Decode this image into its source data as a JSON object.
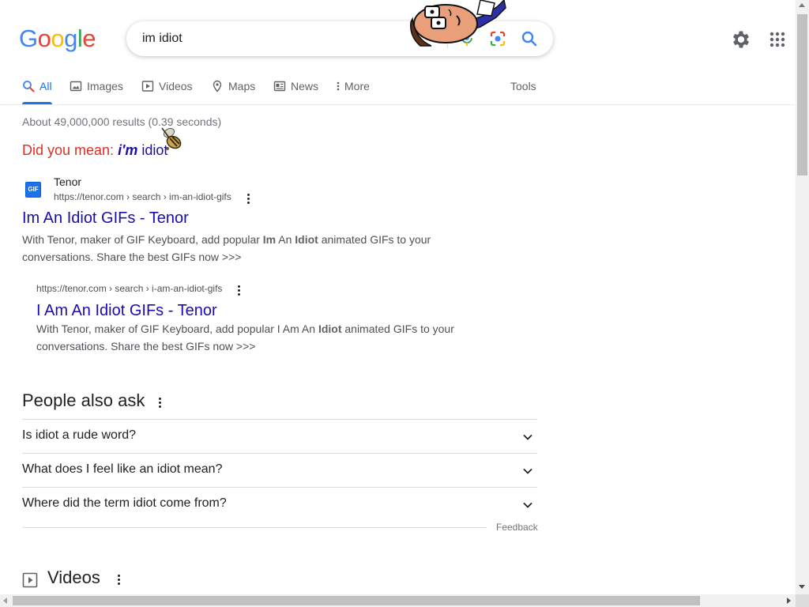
{
  "header": {
    "logo": {
      "letters": [
        "G",
        "o",
        "o",
        "g",
        "l",
        "e"
      ],
      "colors": [
        "#4285F4",
        "#EA4335",
        "#FBBC05",
        "#4285F4",
        "#34A853",
        "#EA4335"
      ]
    },
    "search": {
      "value": "im idiot"
    }
  },
  "tabs": [
    {
      "label": "All",
      "icon": "search-icon",
      "active": true
    },
    {
      "label": "Images",
      "icon": "image-icon"
    },
    {
      "label": "Videos",
      "icon": "play-icon"
    },
    {
      "label": "Maps",
      "icon": "map-pin-icon"
    },
    {
      "label": "News",
      "icon": "newspaper-icon"
    },
    {
      "label": "More",
      "icon": "more-vert-icon"
    },
    {
      "label": "Tools"
    }
  ],
  "results": {
    "stats": "About 49,000,000 results (0.39 seconds)",
    "did_you_mean": {
      "prefix": "Did you mean: ",
      "correction_bold": "i'm",
      "correction_rest": " idiot"
    },
    "items": [
      {
        "site": "Tenor",
        "favicon_text": "GIF",
        "url": "https://tenor.com › search › im-an-idiot-gifs",
        "title": "Im An Idiot GIFs - Tenor",
        "snippet": [
          {
            "t": "With Tenor, maker of GIF Keyboard, add popular "
          },
          {
            "t": "Im",
            "b": true
          },
          {
            "t": " An "
          },
          {
            "t": "Idiot",
            "b": true
          },
          {
            "t": " animated GIFs to your conversations. Share the best GIFs now >>>"
          }
        ]
      },
      {
        "url": "https://tenor.com › search › i-am-an-idiot-gifs",
        "title": "I Am An Idiot GIFs - Tenor",
        "snippet": [
          {
            "t": "With Tenor, maker of GIF Keyboard, add popular I Am An "
          },
          {
            "t": "Idiot",
            "b": true
          },
          {
            "t": " animated GIFs to your conversations. Share the best GIFs now >>>"
          }
        ]
      }
    ]
  },
  "people_also_ask": {
    "title": "People also ask",
    "questions": [
      "Is idiot a rude word?",
      "What does I feel like an idiot mean?",
      "Where did the term idiot come from?"
    ],
    "feedback": "Feedback"
  },
  "videos": {
    "title": "Videos"
  }
}
